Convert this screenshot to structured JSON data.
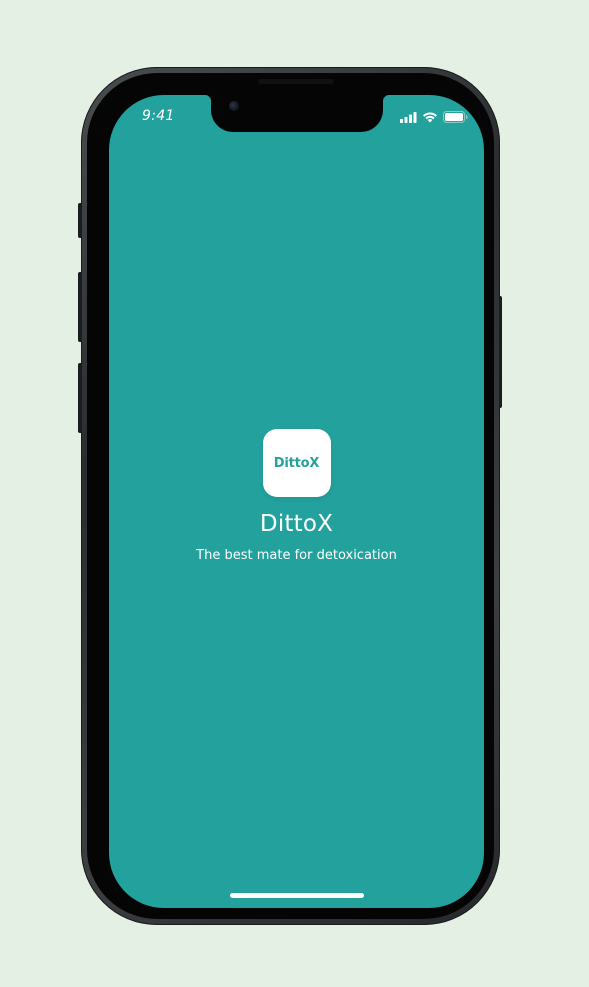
{
  "status_bar": {
    "time": "9:41",
    "icons": [
      "cellular-signal-icon",
      "wifi-icon",
      "battery-icon"
    ]
  },
  "app": {
    "icon_text": "DittoX",
    "name": "DittoX",
    "tagline": "The best mate for detoxication"
  },
  "colors": {
    "background": "#e3f0e3",
    "screen": "#23a19d",
    "text": "#ffffff",
    "icon_bg": "#ffffff"
  }
}
